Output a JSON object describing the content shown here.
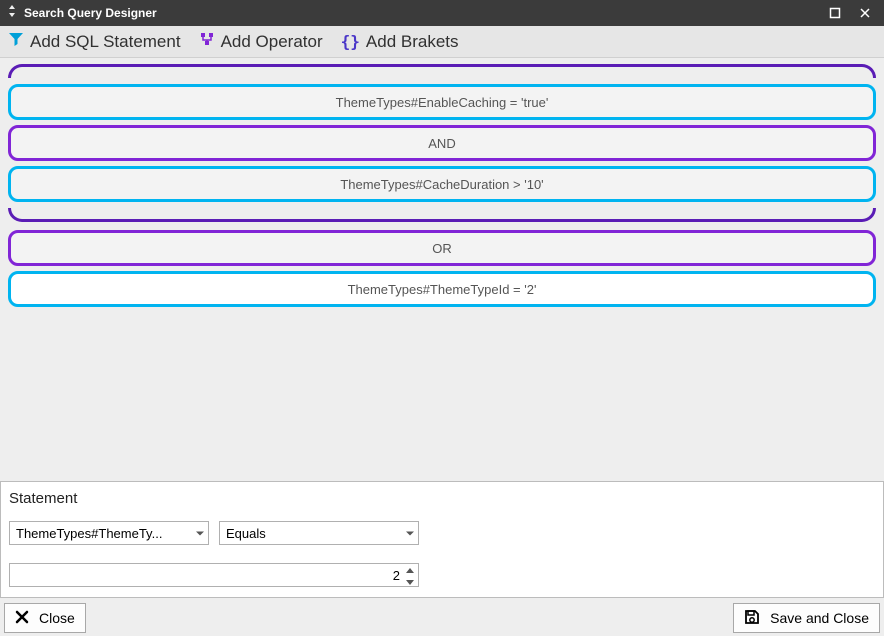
{
  "window": {
    "title": "Search Query Designer"
  },
  "toolbar": {
    "add_sql": "Add SQL Statement",
    "add_operator": "Add Operator",
    "add_brackets": "Add Brakets"
  },
  "designer": {
    "clauses": [
      {
        "kind": "bracket_open"
      },
      {
        "kind": "sql",
        "text": "ThemeTypes#EnableCaching = 'true'"
      },
      {
        "kind": "oper",
        "text": "AND"
      },
      {
        "kind": "sql",
        "text": "ThemeTypes#CacheDuration > '10'"
      },
      {
        "kind": "bracket_close"
      },
      {
        "kind": "oper",
        "text": "OR"
      },
      {
        "kind": "sql",
        "text": "ThemeTypes#ThemeTypeId = '2'",
        "selected": true
      }
    ]
  },
  "statement": {
    "header": "Statement",
    "field": "ThemeTypes#ThemeTy...",
    "operator": "Equals",
    "value": "2"
  },
  "footer": {
    "close": "Close",
    "save": "Save and Close"
  }
}
